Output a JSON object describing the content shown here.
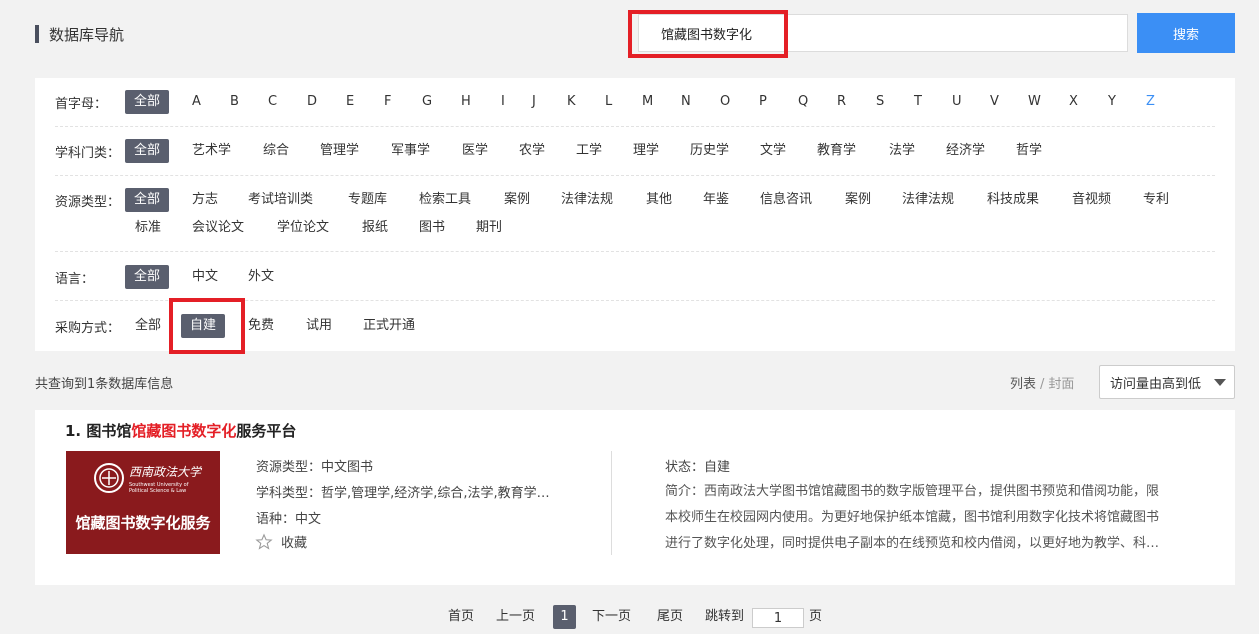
{
  "header": {
    "title": "数据库导航",
    "search_value": "馆藏图书数字化",
    "search_button": "搜索"
  },
  "filters": {
    "letter": {
      "label": "首字母：",
      "items": [
        "全部",
        "A",
        "B",
        "C",
        "D",
        "E",
        "F",
        "G",
        "H",
        "I",
        "J",
        "K",
        "L",
        "M",
        "N",
        "O",
        "P",
        "Q",
        "R",
        "S",
        "T",
        "U",
        "V",
        "W",
        "X",
        "Y",
        "Z"
      ],
      "active": "全部"
    },
    "subject": {
      "label": "学科门类：",
      "items": [
        "全部",
        "艺术学",
        "综合",
        "管理学",
        "军事学",
        "医学",
        "农学",
        "工学",
        "理学",
        "历史学",
        "文学",
        "教育学",
        "法学",
        "经济学",
        "哲学"
      ],
      "active": "全部"
    },
    "resource": {
      "label": "资源类型：",
      "items": [
        "全部",
        "方志",
        "考试培训类",
        "专题库",
        "检索工具",
        "案例",
        "法律法规",
        "其他",
        "年鉴",
        "信息咨讯",
        "案例",
        "法律法规",
        "科技成果",
        "音视频",
        "专利",
        "标准",
        "会议论文",
        "学位论文",
        "报纸",
        "图书",
        "期刊"
      ],
      "active": "全部"
    },
    "language": {
      "label": "语言：",
      "items": [
        "全部",
        "中文",
        "外文"
      ],
      "active": "全部"
    },
    "purchase": {
      "label": "采购方式：",
      "items": [
        "全部",
        "自建",
        "免费",
        "试用",
        "正式开通"
      ],
      "active": "自建"
    }
  },
  "results": {
    "count_text": "共查询到1条数据库信息",
    "view_list": "列表",
    "view_sep": "/",
    "view_cover": "封面",
    "sort_value": "访问量由高到低"
  },
  "item": {
    "index": "1.",
    "title_pre": "图书馆",
    "title_hl": "馆藏图书数字化",
    "title_post": "服务平台",
    "thumb_text": "馆藏图书数字化服务",
    "thumb_univ_en_1": "Southwest University of",
    "thumb_univ_en_2": "Political Science & Law",
    "thumb_univ_cn": "西南政法大学",
    "resource_type_k": "资源类型：",
    "resource_type_v": "中文图书",
    "subject_type_k": "学科类型：",
    "subject_type_v": "哲学,管理学,经济学,综合,法学,教育学…",
    "language_k": "语种：",
    "language_v": "中文",
    "favorite": "收藏",
    "status_k": "状态：",
    "status_v": "自建",
    "desc_k": "简介：",
    "desc_line1": "西南政法大学图书馆馆藏图书的数字版管理平台，提供图书预览和借阅功能，限",
    "desc_line2": "本校师生在校园网内使用。为更好地保护纸本馆藏，图书馆利用数字化技术将馆藏图书",
    "desc_line3": "进行了数字化处理，同时提供电子副本的在线预览和校内借阅，以更好地为教学、科…"
  },
  "pagination": {
    "first": "首页",
    "prev": "上一页",
    "current": "1",
    "next": "下一页",
    "last": "尾页",
    "jump": "跳转到",
    "jump_value": "1",
    "page_unit": "页"
  },
  "colors": {
    "accent": "#3b8ff5",
    "active_tag": "#5a5f6e",
    "highlight": "#e41f26",
    "thumb_bg": "#8a1a1d"
  }
}
